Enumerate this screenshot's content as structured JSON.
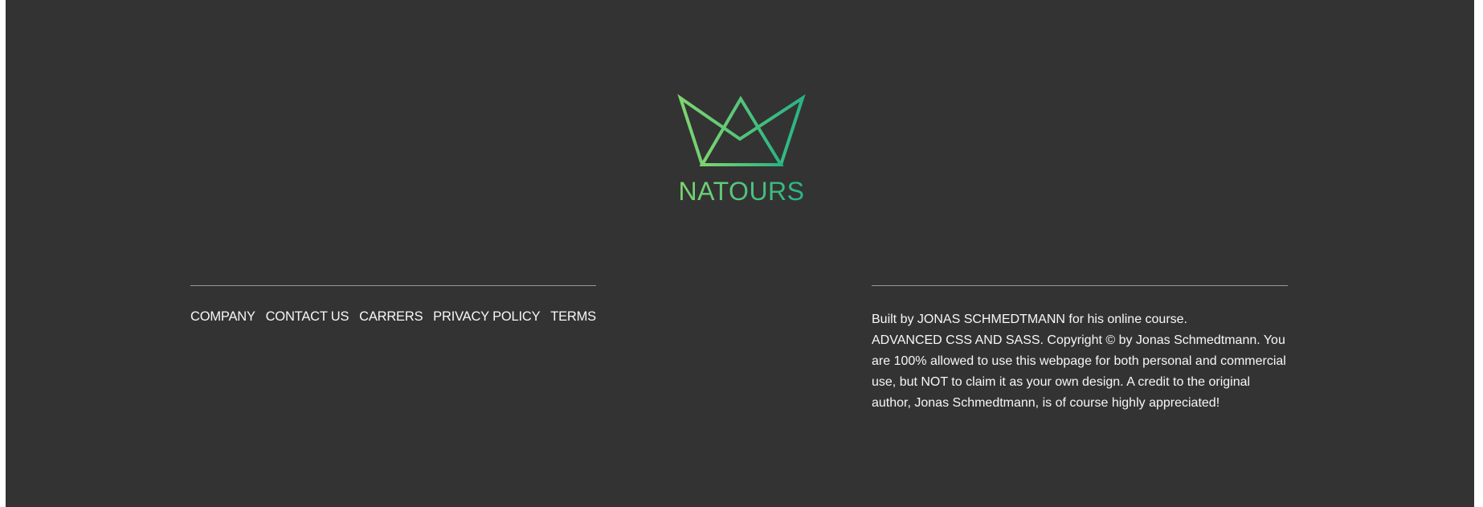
{
  "brand": {
    "name": "NATOURS",
    "logo_icon": "crown-logo-icon",
    "colors": {
      "gradient_start": "#7ed56f",
      "gradient_end": "#28b485"
    }
  },
  "footer": {
    "background": "#333333",
    "nav": [
      {
        "label": "COMPANY"
      },
      {
        "label": "CONTACT US"
      },
      {
        "label": "CARRERS"
      },
      {
        "label": "PRIVACY POLICY"
      },
      {
        "label": "TERMS"
      }
    ],
    "copyright": {
      "line1": "Built by JONAS SCHMEDTMANN for his online course.",
      "line2": "ADVANCED CSS AND SASS. Copyright © by Jonas Schmedtmann. You are 100% allowed to use this webpage for both personal and commercial use, but NOT to claim it as your own design. A credit to the original author, Jonas Schmedtmann, is of course highly appreciated!"
    }
  }
}
